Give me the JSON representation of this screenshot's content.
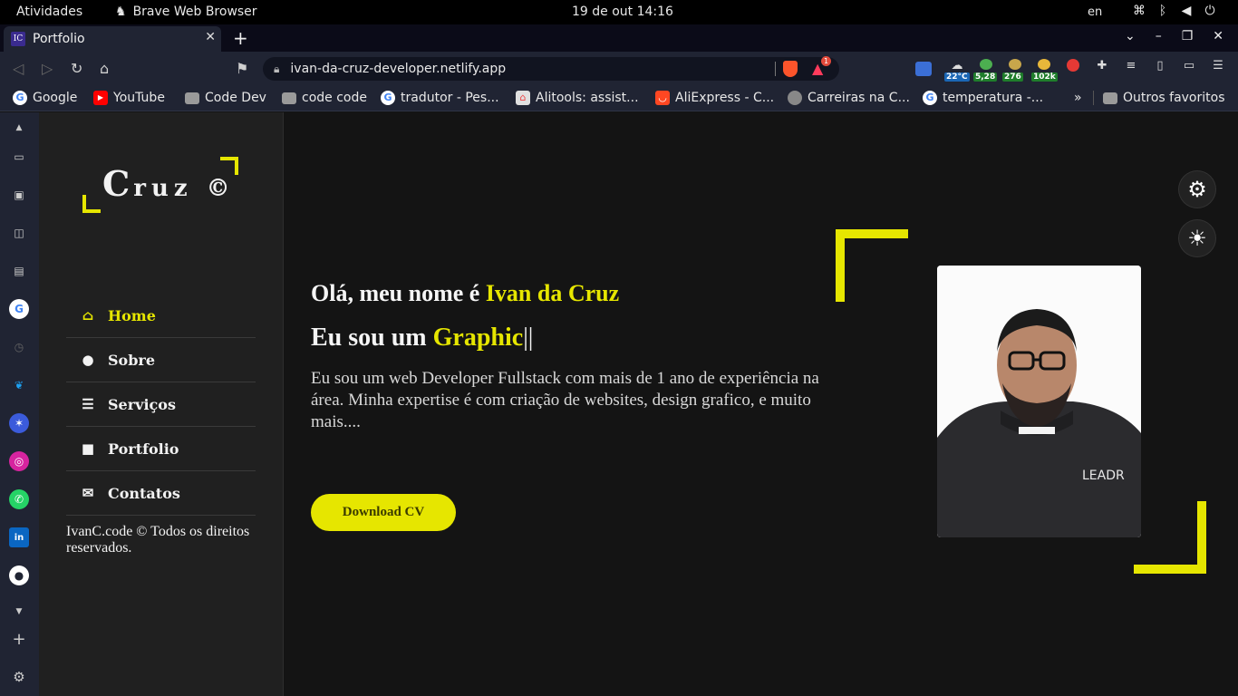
{
  "system": {
    "activities": "Atividades",
    "app_name": "Brave Web Browser",
    "clock": "19 de out  14:16",
    "lang": "en"
  },
  "browser": {
    "tab_title": "Portfolio",
    "tab_favicon": "IC",
    "url": "ivan-da-cruz-developer.netlify.app",
    "rewards_count": "1",
    "extensions": [
      {
        "name": "translate-icon",
        "badge": ""
      },
      {
        "name": "weather-icon",
        "badge": "22°C"
      },
      {
        "name": "ext-green-icon",
        "badge": "5,28"
      },
      {
        "name": "ext-taco-icon",
        "badge": "276"
      },
      {
        "name": "ext-pizza-icon",
        "badge": "102k"
      },
      {
        "name": "tomato-icon",
        "badge": ""
      }
    ]
  },
  "bookmarks": [
    {
      "label": "Google",
      "icon": "google-icon"
    },
    {
      "label": "YouTube",
      "icon": "youtube-icon"
    },
    {
      "label": "Code Dev",
      "icon": "folder-icon"
    },
    {
      "label": "code code",
      "icon": "folder-icon"
    },
    {
      "label": "tradutor - Pes...",
      "icon": "google-icon"
    },
    {
      "label": "Alitools: assist...",
      "icon": "alitools-icon"
    },
    {
      "label": "AliExpress - C...",
      "icon": "aliexpress-icon"
    },
    {
      "label": "Carreiras na C...",
      "icon": "globe-icon"
    },
    {
      "label": "temperatura -...",
      "icon": "google-icon"
    }
  ],
  "bookmarks_more": "»",
  "bookmarks_other": "Outros favoritos",
  "site": {
    "logo_main": "C",
    "logo_rest": "ruz ©",
    "menu": [
      {
        "label": "Home",
        "icon": "home-icon",
        "glyph": "⌂"
      },
      {
        "label": "Sobre",
        "icon": "user-icon",
        "glyph": "●"
      },
      {
        "label": "Serviços",
        "icon": "list-icon",
        "glyph": "☰"
      },
      {
        "label": "Portfolio",
        "icon": "briefcase-icon",
        "glyph": "■"
      },
      {
        "label": "Contatos",
        "icon": "comments-icon",
        "glyph": "✉"
      }
    ],
    "copyright": "IvanC.code © Todos os direitos reservados.",
    "greeting_prefix": "Olá, meu nome é ",
    "greeting_name": "Ivan da Cruz",
    "role_prefix": "Eu sou um ",
    "role_typed": "Graphic",
    "role_cursor": "||",
    "description": "Eu sou um web Developer Fullstack com mais de 1 ano de experiência na área. Minha expertise é com criação de websites, design grafico, e muito mais....",
    "download_label": "Download CV",
    "accent_color": "#e6e600"
  }
}
